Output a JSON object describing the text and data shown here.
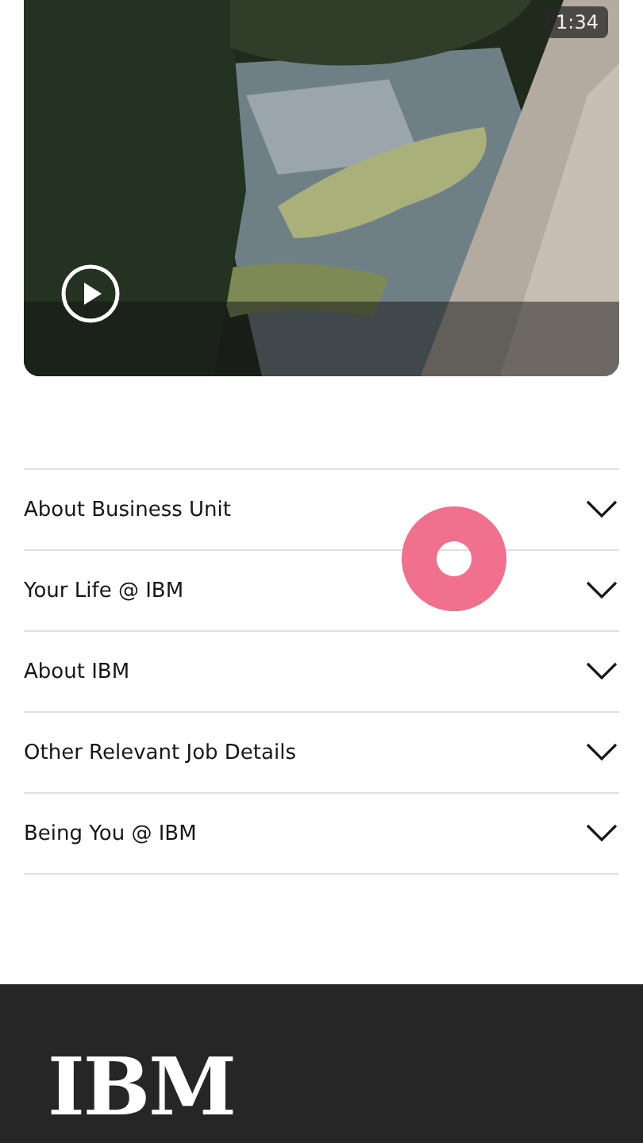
{
  "video": {
    "duration": "1:34"
  },
  "accordion": [
    {
      "title": "About Business Unit",
      "expanded": false
    },
    {
      "title": "Your Life @ IBM",
      "expanded": false
    },
    {
      "title": "About IBM",
      "expanded": false
    },
    {
      "title": "Other Relevant Job Details",
      "expanded": false
    },
    {
      "title": "Being You @ IBM",
      "expanded": false
    }
  ],
  "footer": {
    "logo": "IBM"
  }
}
